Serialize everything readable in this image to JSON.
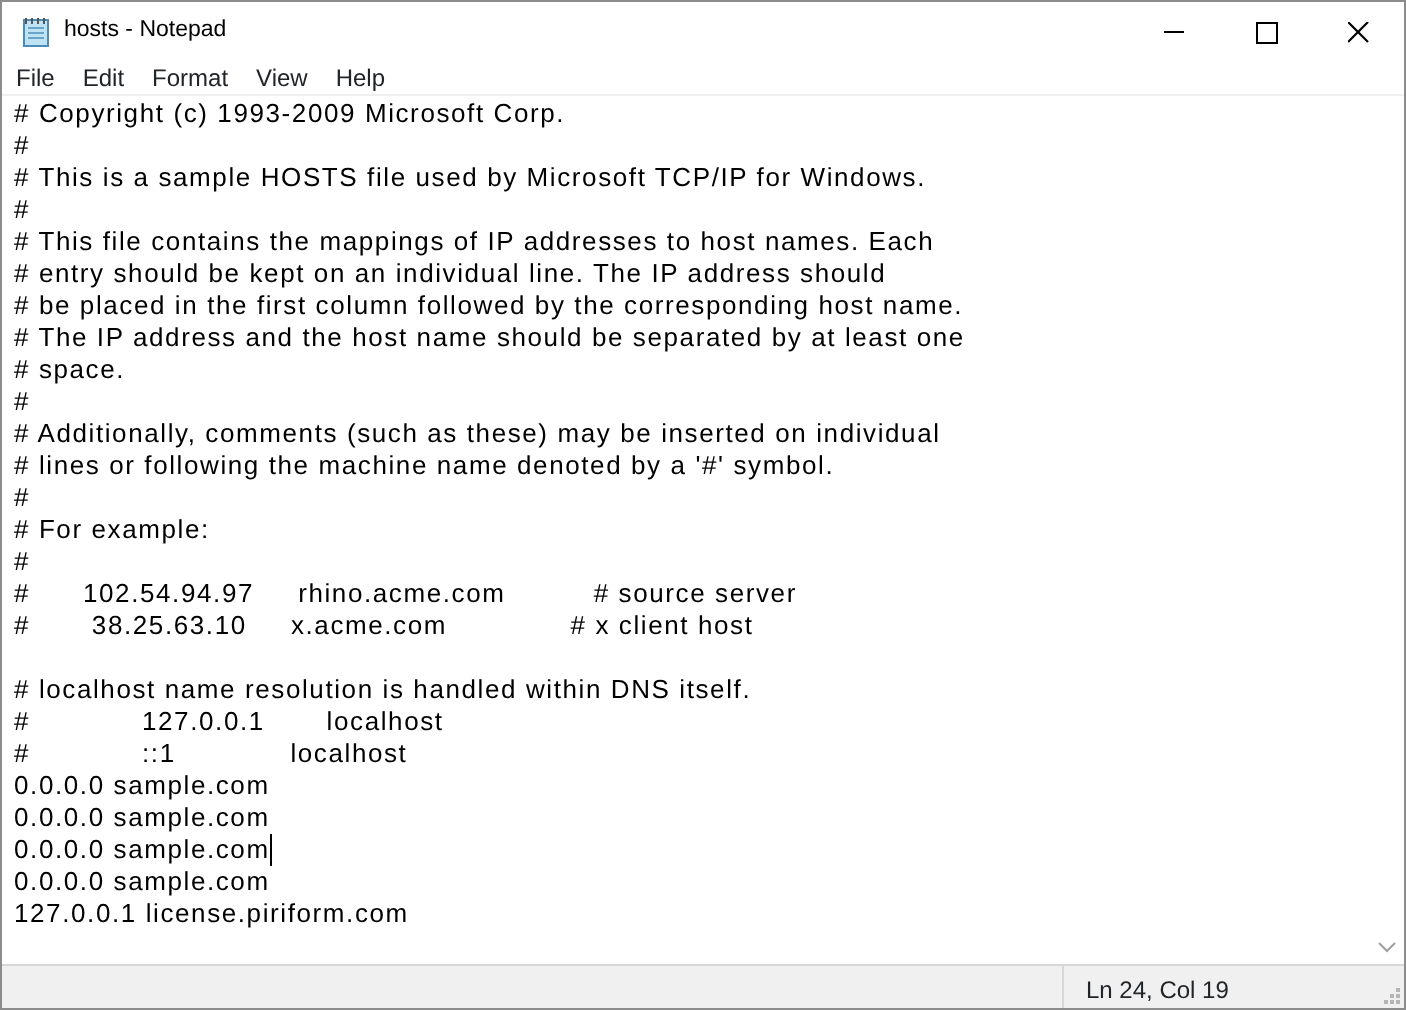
{
  "window": {
    "title": "hosts - Notepad"
  },
  "menu": [
    "File",
    "Edit",
    "Format",
    "View",
    "Help"
  ],
  "lines": [
    {
      "text": "# Copyright (c) 1993-2009 Microsoft Corp.",
      "cursor": false
    },
    {
      "text": "#",
      "cursor": false
    },
    {
      "text": "# This is a sample HOSTS file used by Microsoft TCP/IP for Windows.",
      "cursor": false
    },
    {
      "text": "#",
      "cursor": false
    },
    {
      "text": "# This file contains the mappings of IP addresses to host names. Each",
      "cursor": false
    },
    {
      "text": "# entry should be kept on an individual line. The IP address should",
      "cursor": false
    },
    {
      "text": "# be placed in the first column followed by the corresponding host name.",
      "cursor": false
    },
    {
      "text": "# The IP address and the host name should be separated by at least one",
      "cursor": false
    },
    {
      "text": "# space.",
      "cursor": false
    },
    {
      "text": "#",
      "cursor": false
    },
    {
      "text": "# Additionally, comments (such as these) may be inserted on individual",
      "cursor": false
    },
    {
      "text": "# lines or following the machine name denoted by a '#' symbol.",
      "cursor": false
    },
    {
      "text": "#",
      "cursor": false
    },
    {
      "text": "# For example:",
      "cursor": false
    },
    {
      "text": "#",
      "cursor": false
    },
    {
      "text": "#      102.54.94.97     rhino.acme.com          # source server",
      "cursor": false
    },
    {
      "text": "#       38.25.63.10     x.acme.com              # x client host",
      "cursor": false
    },
    {
      "cursor": false
    },
    {
      "text": "# localhost name resolution is handled within DNS itself.",
      "cursor": false
    },
    {
      "text": "#\t127.0.0.1       localhost",
      "cursor": false
    },
    {
      "text": "#\t::1             localhost",
      "cursor": false
    },
    {
      "text": "0.0.0.0 sample.com",
      "cursor": false
    },
    {
      "text": "0.0.0.0 sample.com",
      "cursor": false
    },
    {
      "text": "0.0.0.0 sample.com",
      "cursor": true
    },
    {
      "text": "0.0.0.0 sample.com",
      "cursor": false
    },
    {
      "text": "127.0.0.1 license.piriform.com",
      "cursor": false
    }
  ],
  "status_bar": {
    "position": "Ln 24, Col 19"
  }
}
